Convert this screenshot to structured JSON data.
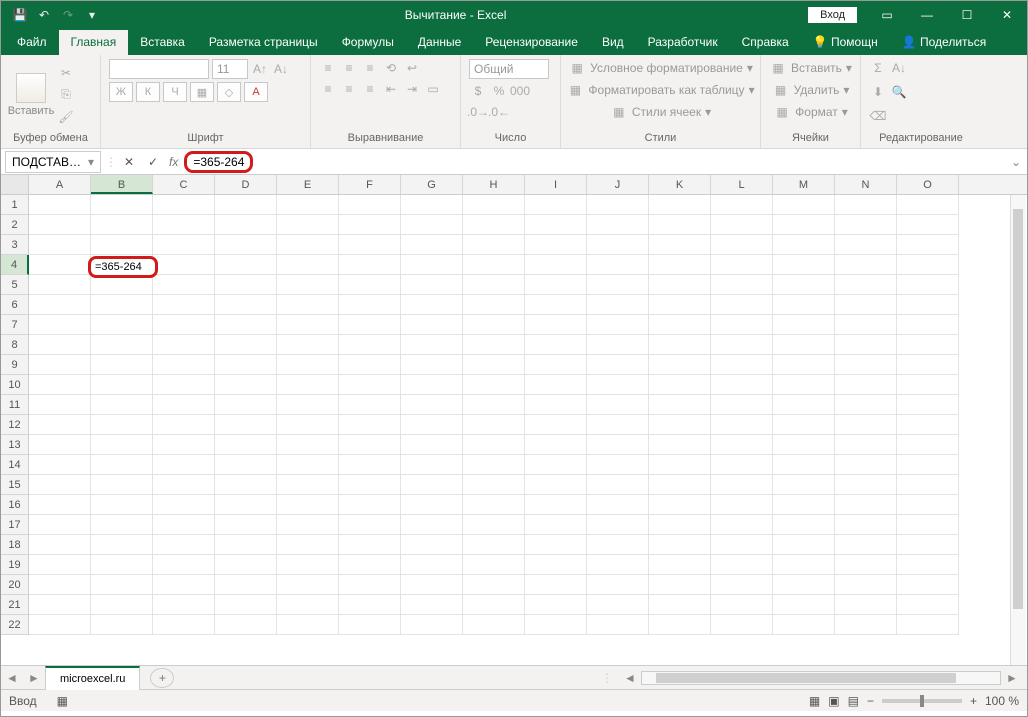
{
  "app": {
    "title": "Вычитание - Excel",
    "login": "Вход"
  },
  "tabs": {
    "file": "Файл",
    "home": "Главная",
    "insert": "Вставка",
    "layout": "Разметка страницы",
    "formulas": "Формулы",
    "data": "Данные",
    "review": "Рецензирование",
    "view": "Вид",
    "dev": "Разработчик",
    "help": "Справка",
    "tell": "Помощн",
    "share": "Поделиться"
  },
  "ribbon": {
    "clipboard": {
      "label": "Буфер обмена",
      "paste": "Вставить"
    },
    "font": {
      "label": "Шрифт",
      "size": "11",
      "bold": "Ж",
      "italic": "К",
      "underline": "Ч"
    },
    "align": {
      "label": "Выравнивание"
    },
    "number": {
      "label": "Число",
      "format": "Общий"
    },
    "styles": {
      "label": "Стили",
      "cond": "Условное форматирование",
      "table": "Форматировать как таблицу",
      "cells": "Стили ячеек"
    },
    "cells": {
      "label": "Ячейки",
      "insert": "Вставить",
      "delete": "Удалить",
      "format": "Формат"
    },
    "editing": {
      "label": "Редактирование"
    }
  },
  "formula": {
    "nameboxValue": "ПОДСТАВ…",
    "text": "=365-264"
  },
  "columns": [
    "A",
    "B",
    "C",
    "D",
    "E",
    "F",
    "G",
    "H",
    "I",
    "J",
    "K",
    "L",
    "M",
    "N",
    "O"
  ],
  "rows": 22,
  "activeCell": {
    "col": "B",
    "row": 4,
    "value": "=365-264"
  },
  "sheet": {
    "name": "microexcel.ru"
  },
  "status": {
    "mode": "Ввод",
    "zoom": "100 %"
  }
}
